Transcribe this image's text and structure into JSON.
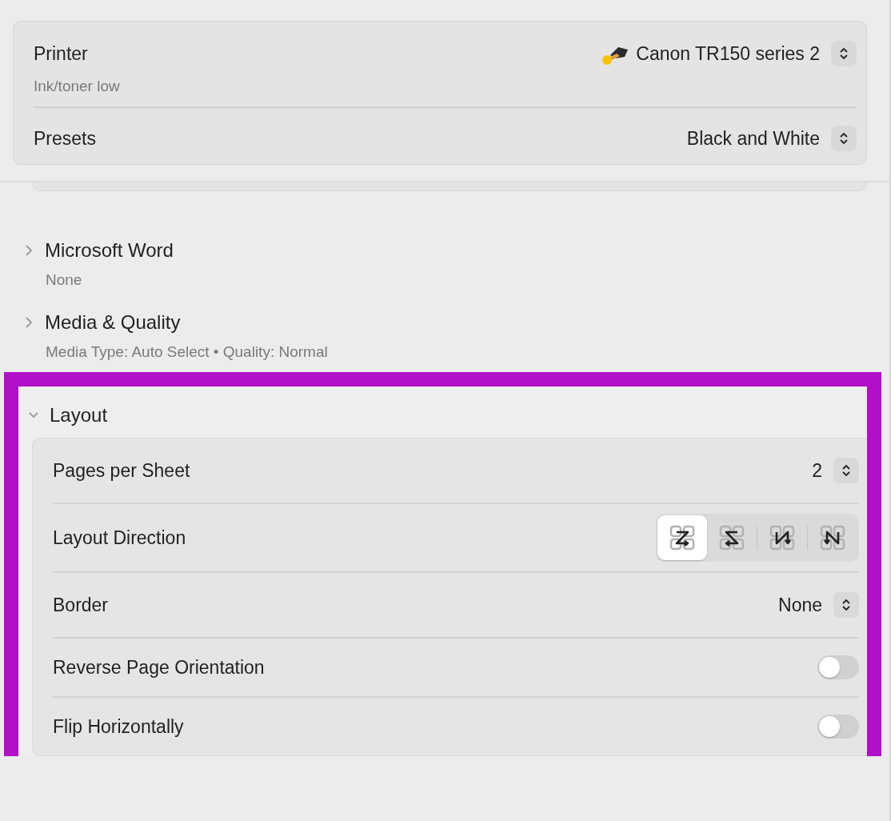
{
  "printer_panel": {
    "rows": [
      {
        "kind": "printer",
        "label": "Printer",
        "sublabel": "Ink/toner low",
        "value": "Canon TR150 series 2"
      },
      {
        "kind": "popup",
        "label": "Presets",
        "value": "Black and White"
      }
    ]
  },
  "sections": [
    {
      "title": "Microsoft Word",
      "summary": "None",
      "expanded": false,
      "highlighted": false
    },
    {
      "title": "Media & Quality",
      "summary": "Media Type: Auto Select • Quality: Normal",
      "expanded": false,
      "highlighted": false
    },
    {
      "title": "Layout",
      "expanded": true,
      "highlighted": true,
      "settings": [
        {
          "kind": "popup",
          "label": "Pages per Sheet",
          "value": "2"
        },
        {
          "kind": "segmented",
          "label": "Layout Direction",
          "options": [
            {
              "selected": true
            },
            {
              "selected": false
            },
            {
              "selected": false
            },
            {
              "selected": false
            }
          ]
        },
        {
          "kind": "popup",
          "label": "Border",
          "value": "None"
        },
        {
          "kind": "switch",
          "label": "Reverse Page Orientation",
          "on": false
        },
        {
          "kind": "switch",
          "label": "Flip Horizontally",
          "on": false
        }
      ]
    }
  ]
}
